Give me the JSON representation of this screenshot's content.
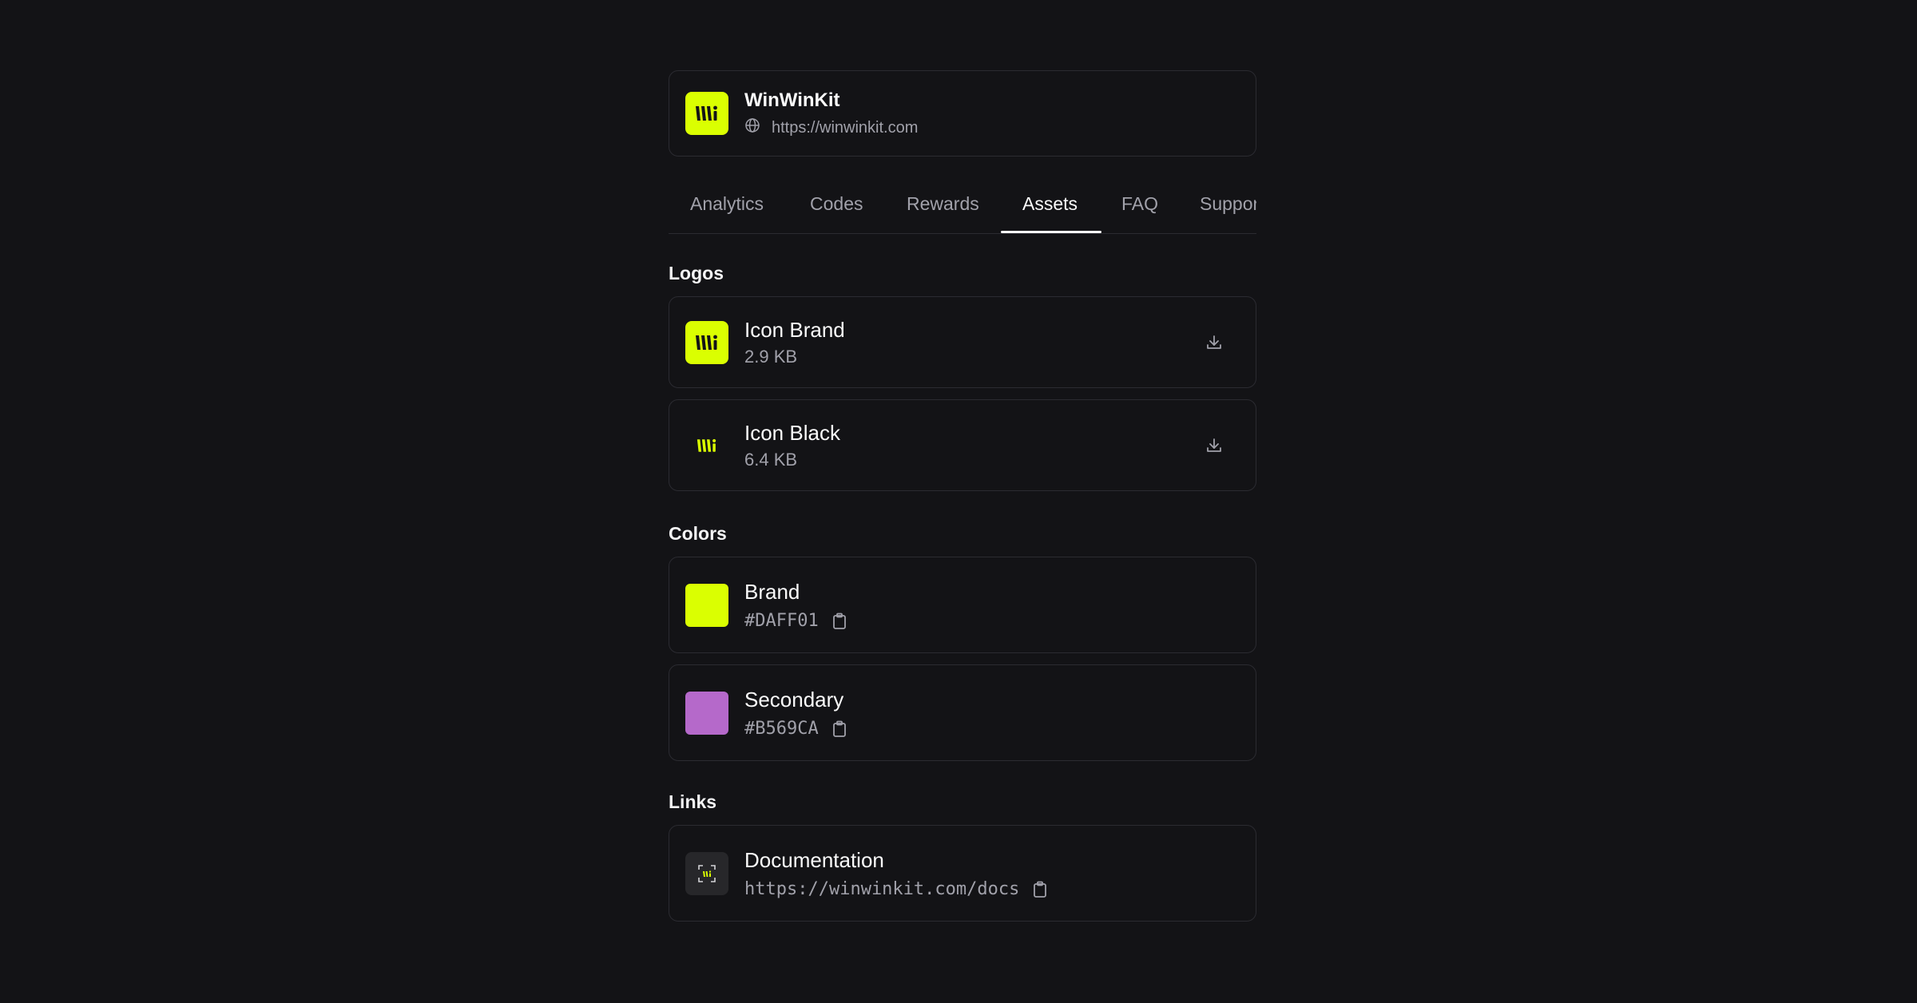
{
  "header": {
    "name": "WinWinKit",
    "url": "https://winwinkit.com",
    "logo_icon": "brand-logo-icon",
    "globe_icon": "globe-icon"
  },
  "tabs": [
    {
      "label": "Analytics",
      "active": false
    },
    {
      "label": "Codes",
      "active": false
    },
    {
      "label": "Rewards",
      "active": false
    },
    {
      "label": "Assets",
      "active": true
    },
    {
      "label": "FAQ",
      "active": false
    },
    {
      "label": "Support",
      "active": false
    }
  ],
  "sections": {
    "logos": {
      "title": "Logos",
      "items": [
        {
          "title": "Icon Brand",
          "size": "2.9 KB",
          "action_icon": "download-icon"
        },
        {
          "title": "Icon Black",
          "size": "6.4 KB",
          "action_icon": "download-icon"
        }
      ]
    },
    "colors": {
      "title": "Colors",
      "items": [
        {
          "title": "Brand",
          "hex": "#DAFF01",
          "color": "#daff01",
          "action_icon": "clipboard-icon"
        },
        {
          "title": "Secondary",
          "hex": "#B569CA",
          "color": "#b569ca",
          "action_icon": "clipboard-icon"
        }
      ]
    },
    "links": {
      "title": "Links",
      "items": [
        {
          "title": "Documentation",
          "url": "https://winwinkit.com/docs",
          "action_icon": "clipboard-icon"
        }
      ]
    }
  },
  "colors": {
    "background": "#131316",
    "border": "#2b2b31",
    "brand": "#daff01",
    "secondary": "#b569ca",
    "muted_text": "#a1a1aa"
  }
}
